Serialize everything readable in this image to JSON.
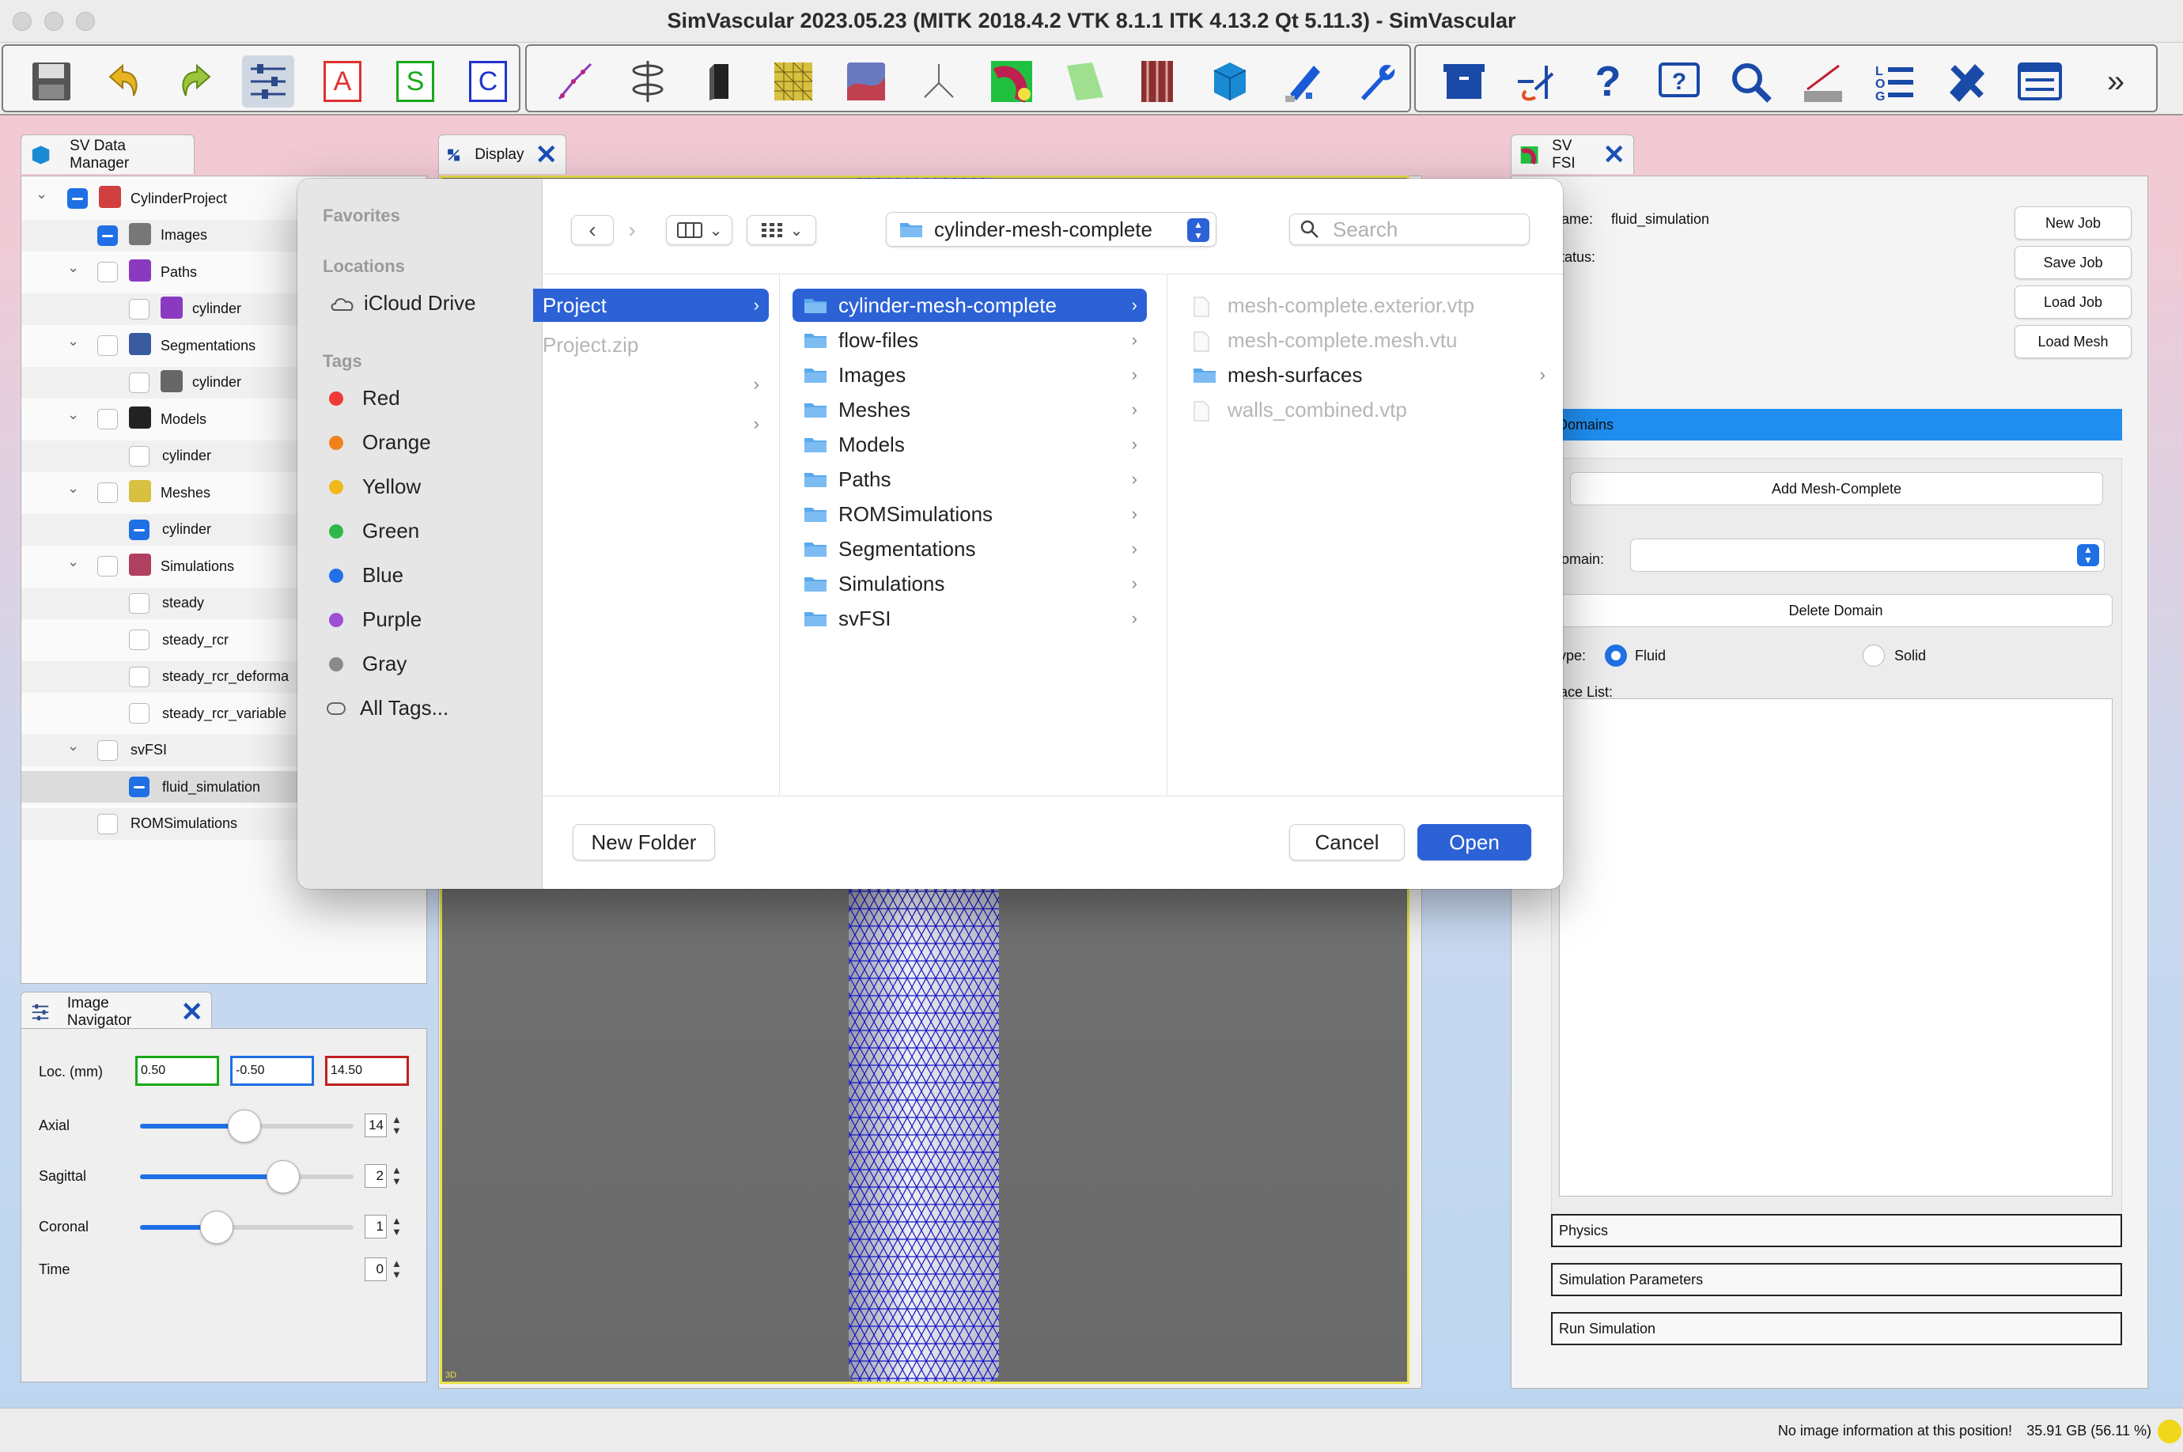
{
  "window": {
    "title": "SimVascular 2023.05.23 (MITK 2018.4.2 VTK 8.1.1 ITK 4.13.2 Qt 5.11.3) - SimVascular"
  },
  "toolbar": {
    "letters": [
      "A",
      "S",
      "C"
    ],
    "overflow": "»",
    "colors": {
      "A": "#e03030",
      "S": "#18a818",
      "C": "#2233cc"
    }
  },
  "data_manager": {
    "tab_label": "SV Data Manager",
    "tree": [
      {
        "label": "CylinderProject",
        "level": 0,
        "checked": true
      },
      {
        "label": "Images",
        "level": 1,
        "checked": true
      },
      {
        "label": "Paths",
        "level": 1,
        "checked": false
      },
      {
        "label": "cylinder",
        "level": 2,
        "checked": false
      },
      {
        "label": "Segmentations",
        "level": 1,
        "checked": false
      },
      {
        "label": "cylinder",
        "level": 2,
        "checked": false
      },
      {
        "label": "Models",
        "level": 1,
        "checked": false
      },
      {
        "label": "cylinder",
        "level": 2,
        "checked": false
      },
      {
        "label": "Meshes",
        "level": 1,
        "checked": false
      },
      {
        "label": "cylinder",
        "level": 2,
        "checked": true
      },
      {
        "label": "Simulations",
        "level": 1,
        "checked": false
      },
      {
        "label": "steady",
        "level": 2,
        "checked": false
      },
      {
        "label": "steady_rcr",
        "level": 2,
        "checked": false
      },
      {
        "label": "steady_rcr_deforma",
        "level": 2,
        "checked": false
      },
      {
        "label": "steady_rcr_variable",
        "level": 2,
        "checked": false
      },
      {
        "label": "svFSI",
        "level": 1,
        "checked": false
      },
      {
        "label": "fluid_simulation",
        "level": 2,
        "checked": true
      },
      {
        "label": "ROMSimulations",
        "level": 1,
        "checked": false
      }
    ]
  },
  "image_navigator": {
    "tab_label": "Image Navigator",
    "loc_label": "Loc. (mm)",
    "loc_values": [
      "0.50",
      "-0.50",
      "14.50"
    ],
    "sliders": [
      {
        "label": "Axial",
        "value": "14",
        "fraction": 0.49
      },
      {
        "label": "Sagittal",
        "value": "2",
        "fraction": 0.67
      },
      {
        "label": "Coronal",
        "value": "1",
        "fraction": 0.36
      }
    ],
    "time_label": "Time",
    "time_value": "0"
  },
  "display": {
    "tab_label": "Display",
    "corner_label": "3D"
  },
  "sv_fsi": {
    "tab_label": "SV FSI",
    "name_label": "Name:",
    "name_value": "fluid_simulation",
    "status_label": "Status:",
    "buttons": [
      "New Job",
      "Save Job",
      "Load Job",
      "Load Mesh"
    ],
    "domains_header": "Domains",
    "add_mesh_button": "Add Mesh-Complete",
    "domain_label": "Domain:",
    "domain_value": "",
    "delete_domain_button": "Delete Domain",
    "type_label": "Type:",
    "type_options": [
      "Fluid",
      "Solid"
    ],
    "type_selected": "Fluid",
    "face_list_label": "Face List:",
    "sections": [
      "Physics",
      "Simulation Parameters",
      "Run Simulation"
    ]
  },
  "status_bar": {
    "message": "No image information at this position!",
    "memory": "35.91 GB (56.11 %)"
  },
  "file_dialog": {
    "sidebar": {
      "favorites_header": "Favorites",
      "locations_header": "Locations",
      "locations": [
        "iCloud Drive"
      ],
      "tags_header": "Tags",
      "tags": [
        {
          "label": "Red",
          "color": "#ee3b36"
        },
        {
          "label": "Orange",
          "color": "#f0821e"
        },
        {
          "label": "Yellow",
          "color": "#f0b81a"
        },
        {
          "label": "Green",
          "color": "#2fb84a"
        },
        {
          "label": "Blue",
          "color": "#2170e8"
        },
        {
          "label": "Purple",
          "color": "#9a4fd4"
        },
        {
          "label": "Gray",
          "color": "#8a8a8a"
        },
        {
          "label": "All Tags...",
          "color": ""
        }
      ]
    },
    "path_popup": "cylinder-mesh-complete",
    "search_placeholder": "Search",
    "column1": [
      {
        "label": "Project",
        "selected": true,
        "folder": false,
        "dim": false,
        "chevron": true
      },
      {
        "label": "Project.zip",
        "selected": false,
        "folder": false,
        "dim": true,
        "chevron": false
      },
      {
        "label": "",
        "selected": false,
        "folder": false,
        "dim": false,
        "chevron": true
      },
      {
        "label": "",
        "selected": false,
        "folder": false,
        "dim": false,
        "chevron": true
      }
    ],
    "column2": [
      {
        "label": "cylinder-mesh-complete",
        "selected": true
      },
      {
        "label": "flow-files",
        "selected": false
      },
      {
        "label": "Images",
        "selected": false
      },
      {
        "label": "Meshes",
        "selected": false
      },
      {
        "label": "Models",
        "selected": false
      },
      {
        "label": "Paths",
        "selected": false
      },
      {
        "label": "ROMSimulations",
        "selected": false
      },
      {
        "label": "Segmentations",
        "selected": false
      },
      {
        "label": "Simulations",
        "selected": false
      },
      {
        "label": "svFSI",
        "selected": false
      }
    ],
    "column3": [
      {
        "label": "mesh-complete.exterior.vtp",
        "folder": false,
        "dim": true
      },
      {
        "label": "mesh-complete.mesh.vtu",
        "folder": false,
        "dim": true
      },
      {
        "label": "mesh-surfaces",
        "folder": true,
        "dim": false
      },
      {
        "label": "walls_combined.vtp",
        "folder": false,
        "dim": true
      }
    ],
    "new_folder_button": "New Folder",
    "cancel_button": "Cancel",
    "open_button": "Open",
    "accent": "#2c62d6"
  }
}
